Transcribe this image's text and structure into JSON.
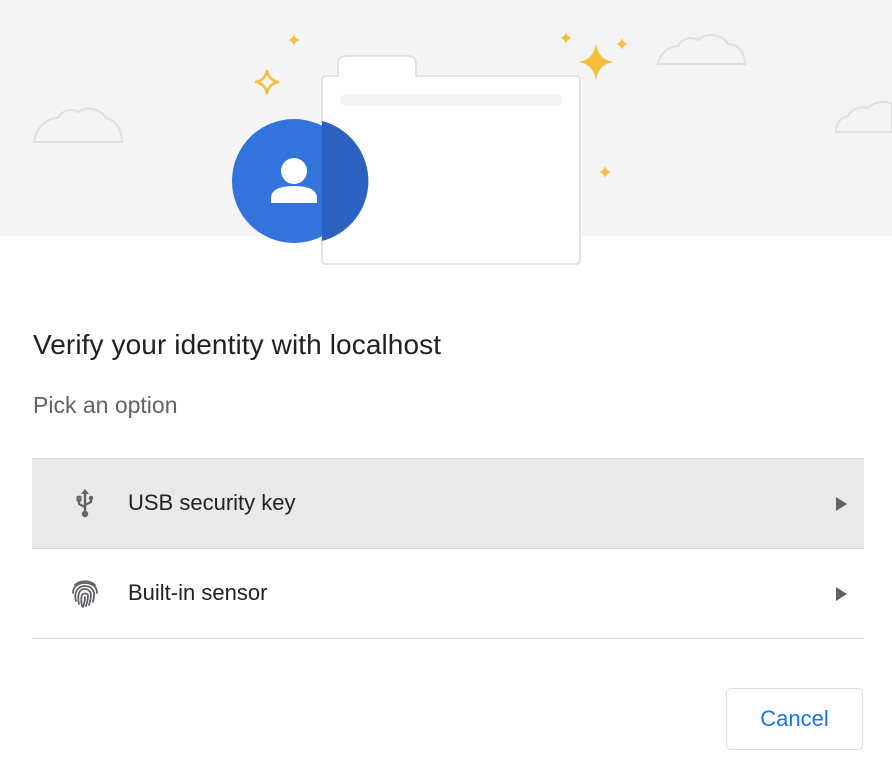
{
  "dialog": {
    "title": "Verify your identity with localhost",
    "subtitle": "Pick an option",
    "options": [
      {
        "label": "USB security key",
        "icon": "usb-icon",
        "selected": true
      },
      {
        "label": "Built-in sensor",
        "icon": "fingerprint-icon",
        "selected": false
      }
    ],
    "cancel_label": "Cancel"
  },
  "colors": {
    "accent": "#1a73e8",
    "avatar_blue": "#3273dc",
    "sparkle_yellow": "#f6bf3b",
    "banner_bg": "#f4f4f4",
    "selected_row_bg": "#e8e9e9"
  }
}
